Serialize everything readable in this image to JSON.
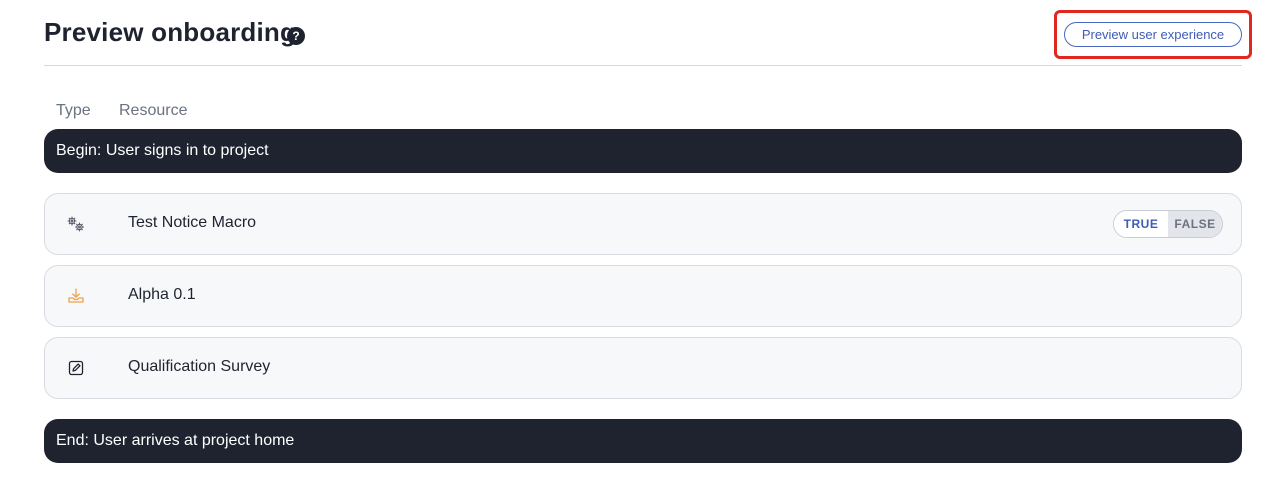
{
  "header": {
    "title": "Preview onboarding",
    "help_glyph": "?",
    "preview_button_label": "Preview user experience"
  },
  "columns": {
    "type": "Type",
    "resource": "Resource"
  },
  "flow": {
    "begin": "Begin: User signs in to project",
    "end": "End: User arrives at project home",
    "items": [
      {
        "icon": "gears-icon",
        "label": "Test Notice Macro",
        "toggle": {
          "true_label": "TRUE",
          "false_label": "FALSE",
          "selected": "FALSE"
        }
      },
      {
        "icon": "download-tray-icon",
        "label": "Alpha 0.1",
        "icon_color": "#f0a24a"
      },
      {
        "icon": "edit-square-icon",
        "label": "Qualification Survey"
      }
    ]
  },
  "colors": {
    "accent": "#3e5bb8",
    "dark_bar": "#1f2330",
    "highlight_frame": "#e0281e"
  }
}
